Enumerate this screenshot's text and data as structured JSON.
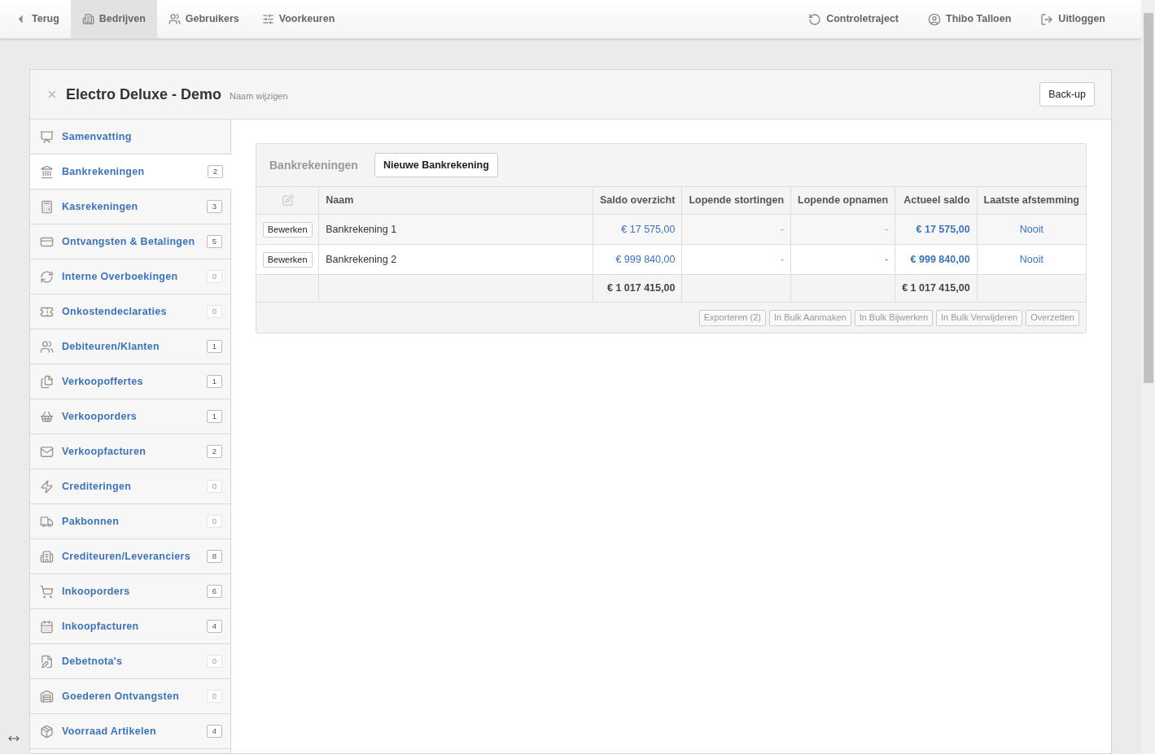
{
  "nav_left": [
    {
      "label": "Terug",
      "selected": false
    },
    {
      "label": "Bedrijven",
      "selected": true
    },
    {
      "label": "Gebruikers",
      "selected": false
    },
    {
      "label": "Voorkeuren",
      "selected": false
    }
  ],
  "nav_right": [
    {
      "label": "Controletraject"
    },
    {
      "label": "Thibo Talloen"
    },
    {
      "label": "Uitloggen"
    }
  ],
  "company": {
    "title": "Electro Deluxe - Demo",
    "rename_link": "Naam wijzigen",
    "backup_button": "Back-up"
  },
  "sidebar": {
    "items": [
      {
        "label": "Samenvatting",
        "selected": false
      },
      {
        "label": "Bankrekeningen",
        "count": "2",
        "dimmed": false,
        "selected": true
      },
      {
        "label": "Kasrekeningen",
        "count": "3",
        "dimmed": false,
        "selected": false
      },
      {
        "label": "Ontvangsten & Betalingen",
        "count": "5",
        "dimmed": false,
        "selected": false
      },
      {
        "label": "Interne Overboekingen",
        "count": "0",
        "dimmed": true,
        "selected": false
      },
      {
        "label": "Onkostendeclaraties",
        "count": "0",
        "dimmed": true,
        "selected": false
      },
      {
        "label": "Debiteuren/Klanten",
        "count": "1",
        "dimmed": false,
        "selected": false
      },
      {
        "label": "Verkoopoffertes",
        "count": "1",
        "dimmed": false,
        "selected": false
      },
      {
        "label": "Verkooporders",
        "count": "1",
        "dimmed": false,
        "selected": false
      },
      {
        "label": "Verkoopfacturen",
        "count": "2",
        "dimmed": false,
        "selected": false
      },
      {
        "label": "Crediteringen",
        "count": "0",
        "dimmed": true,
        "selected": false
      },
      {
        "label": "Pakbonnen",
        "count": "0",
        "dimmed": true,
        "selected": false
      },
      {
        "label": "Crediteuren/Leveranciers",
        "count": "8",
        "dimmed": false,
        "selected": false
      },
      {
        "label": "Inkooporders",
        "count": "6",
        "dimmed": false,
        "selected": false
      },
      {
        "label": "Inkoopfacturen",
        "count": "4",
        "dimmed": false,
        "selected": false
      },
      {
        "label": "Debetnota's",
        "count": "0",
        "dimmed": true,
        "selected": false
      },
      {
        "label": "Goederen Ontvangsten",
        "count": "0",
        "dimmed": true,
        "selected": false
      },
      {
        "label": "Voorraad Artikelen",
        "count": "4",
        "dimmed": false,
        "selected": false
      }
    ]
  },
  "panel": {
    "title": "Bankrekeningen",
    "new_button": "Nieuwe Bankrekening",
    "table": {
      "columns": [
        "Naam",
        "Saldo overzicht",
        "Lopende stortingen",
        "Lopende opnamen",
        "Actueel saldo",
        "Laatste afstemming"
      ],
      "rows": [
        {
          "edit_button": "Bewerken",
          "naam": "Bankrekening 1",
          "saldo_overzicht": "€ 17 575,00",
          "lopende_stortingen": "-",
          "lopende_opnamen": "-",
          "actueel_saldo": "€ 17 575,00",
          "laatste_afstemming": "Nooit"
        },
        {
          "edit_button": "Bewerken",
          "naam": "Bankrekening 2",
          "saldo_overzicht": "€ 999 840,00",
          "lopende_stortingen": "-",
          "lopende_opnamen": "-",
          "actueel_saldo": "€ 999 840,00",
          "laatste_afstemming": "Nooit"
        }
      ],
      "totals": {
        "saldo_overzicht": "€ 1 017 415,00",
        "actueel_saldo": "€ 1 017 415,00"
      }
    },
    "footer_buttons": [
      "Exporteren (2)",
      "In Bulk Aanmaken",
      "In Bulk Bijwerken",
      "In Bulk Verwijderen",
      "Overzetten"
    ]
  }
}
